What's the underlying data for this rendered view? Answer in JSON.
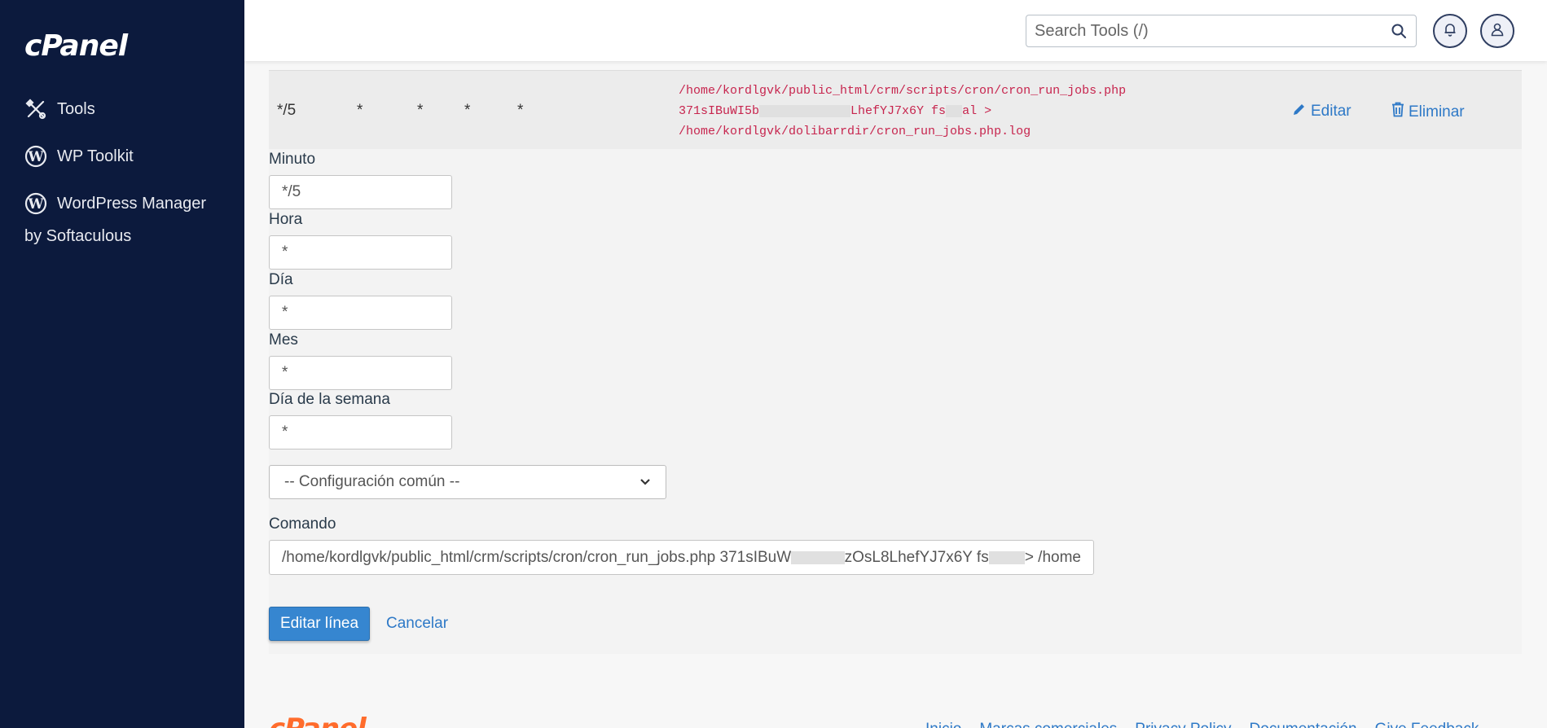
{
  "sidebar": {
    "logo": "cPanel",
    "items": [
      {
        "label": "Tools",
        "icon": "tools-icon"
      },
      {
        "label": "WP Toolkit",
        "icon": "wordpress-icon"
      },
      {
        "label": "WordPress Manager",
        "icon": "wordpress-icon"
      }
    ],
    "subtext": "by Softaculous"
  },
  "header": {
    "search_placeholder": "Search Tools (/)",
    "icons": [
      "search-icon",
      "bell-icon",
      "user-icon"
    ]
  },
  "cron_row": {
    "minute": "*/5",
    "hour": "*",
    "day": "*",
    "month": "*",
    "weekday": "*",
    "command_line1": "/home/kordlgvk/public_html/crm/scripts/cron/cron_run_jobs.php",
    "command_line2a": "371sIBuWI5b",
    "command_line2b": "LhefYJ7x6Y fs",
    "command_line2c": "al >",
    "command_line3": "/home/kordlgvk/dolibarrdir/cron_run_jobs.php.log",
    "edit_label": "Editar",
    "delete_label": "Eliminar"
  },
  "form": {
    "minute_label": "Minuto",
    "minute_value": "*/5",
    "hour_label": "Hora",
    "hour_value": "*",
    "day_label": "Día",
    "day_value": "*",
    "month_label": "Mes",
    "month_value": "*",
    "weekday_label": "Día de la semana",
    "weekday_value": "*",
    "common_settings": "-- Configuración común --",
    "command_label": "Comando",
    "command_part1": "/home/kordlgvk/public_html/crm/scripts/cron/cron_run_jobs.php 371sIBuW",
    "command_part2": "zOsL8LhefYJ7x6Y fs",
    "command_part3": " > /home",
    "submit_label": "Editar línea",
    "cancel_label": "Cancelar"
  },
  "footer": {
    "logo": "cPanel",
    "links": [
      "Inicio",
      "Marcas comerciales",
      "Privacy Policy",
      "Documentación",
      "Give Feedback"
    ]
  },
  "colors": {
    "sidebar_bg": "#0c1a3d",
    "link": "#2e79c7",
    "primary_button": "#3686d0",
    "code": "#c7254e",
    "footer_logo": "#ff6c2c"
  }
}
